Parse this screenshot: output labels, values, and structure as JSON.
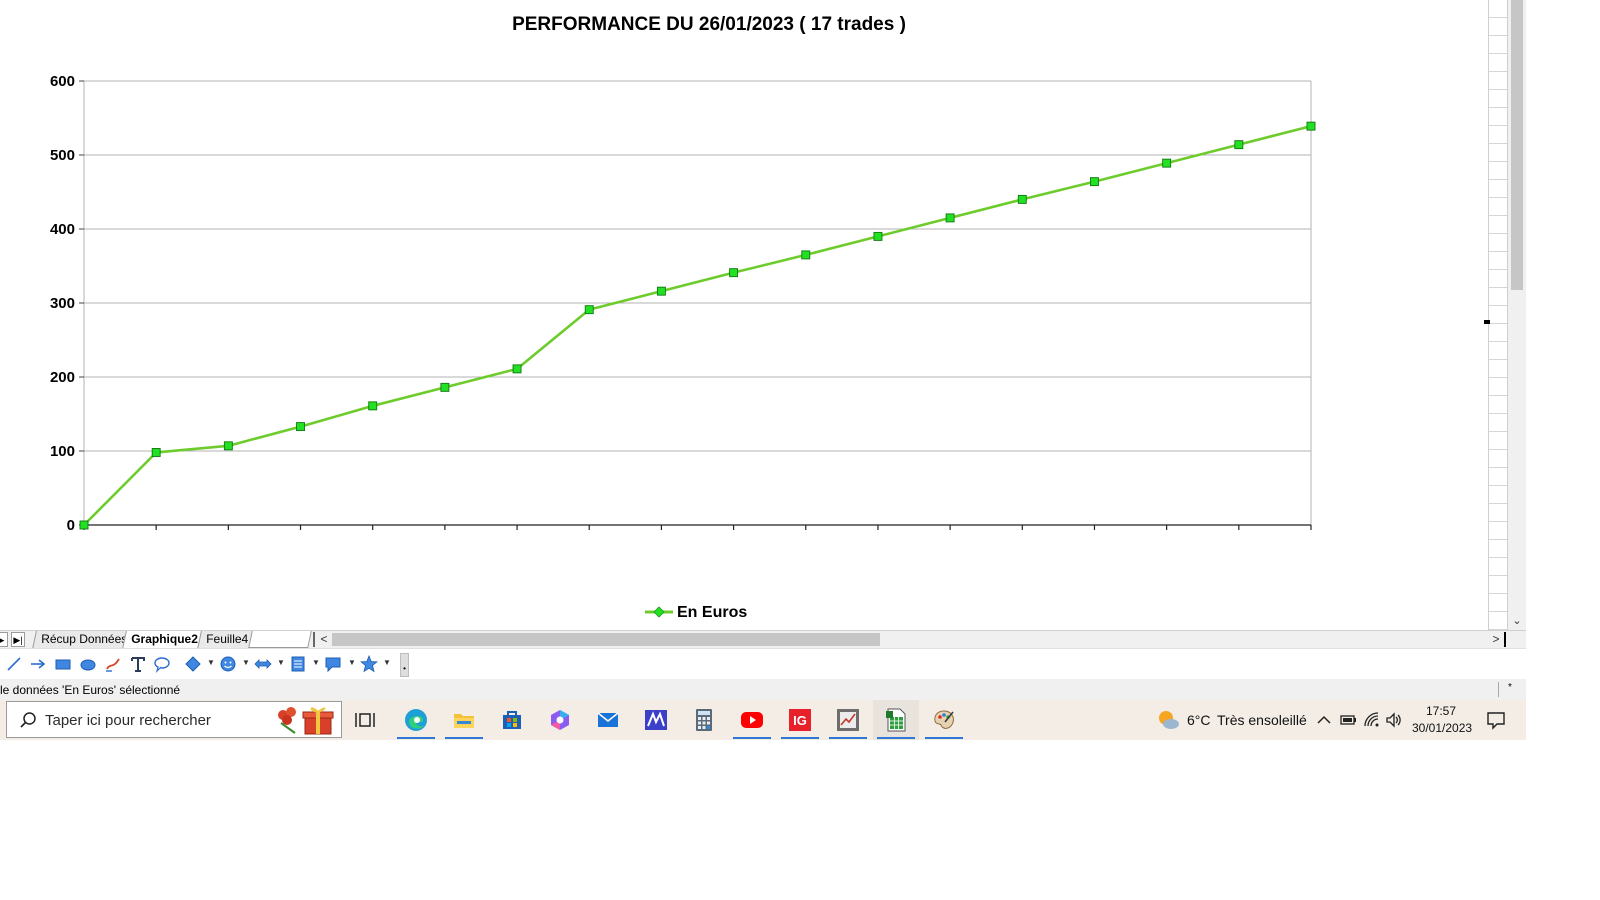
{
  "chart_data": {
    "type": "line",
    "title": "PERFORMANCE DU 26/01/2023 ( 17 trades )",
    "xlabel": "",
    "ylabel": "",
    "ylim": [
      0,
      600
    ],
    "yticks": [
      0,
      100,
      200,
      300,
      400,
      500,
      600
    ],
    "x": [
      0,
      1,
      2,
      3,
      4,
      5,
      6,
      7,
      8,
      9,
      10,
      11,
      12,
      13,
      14,
      15,
      16,
      17
    ],
    "series": [
      {
        "name": "En Euros",
        "color": "#6dcc2c",
        "marker_color": "#22e022",
        "values": [
          0,
          98,
          107,
          133,
          161,
          186,
          211,
          291,
          316,
          341,
          365,
          390,
          415,
          440,
          464,
          489,
          514,
          539
        ]
      }
    ],
    "grid": true,
    "legend_position": "bottom"
  },
  "sheet_tabs": {
    "tabs": [
      "Récup Données",
      "Graphique2",
      "Feuille4"
    ],
    "active": "Graphique2"
  },
  "status_bar": {
    "text": "le données 'En Euros' sélectionné",
    "star": "*"
  },
  "draw_toolbar": {
    "tools": [
      "line-tool-icon",
      "arrow-tool-icon",
      "rectangle-tool-icon",
      "ellipse-tool-icon",
      "freeform-tool-icon",
      "text-tool-icon",
      "callout-tool-icon",
      "basic-shapes-icon",
      "symbol-shapes-icon",
      "block-arrows-icon",
      "flowchart-icon",
      "callouts-icon",
      "stars-icon"
    ]
  },
  "taskbar": {
    "search_placeholder": "Taper ici pour rechercher",
    "apps": [
      "task-view-icon",
      "edge-icon",
      "file-explorer-icon",
      "store-icon",
      "copilot-icon",
      "mail-icon",
      "math-app-icon",
      "calculator-icon",
      "youtube-icon",
      "ig-icon",
      "chart-app-icon",
      "libreoffice-calc-icon",
      "paint-icon"
    ],
    "weather": {
      "temp": "6°C",
      "description": "Très ensoleillé"
    },
    "clock": {
      "time": "17:57",
      "date": "30/01/2023"
    }
  }
}
